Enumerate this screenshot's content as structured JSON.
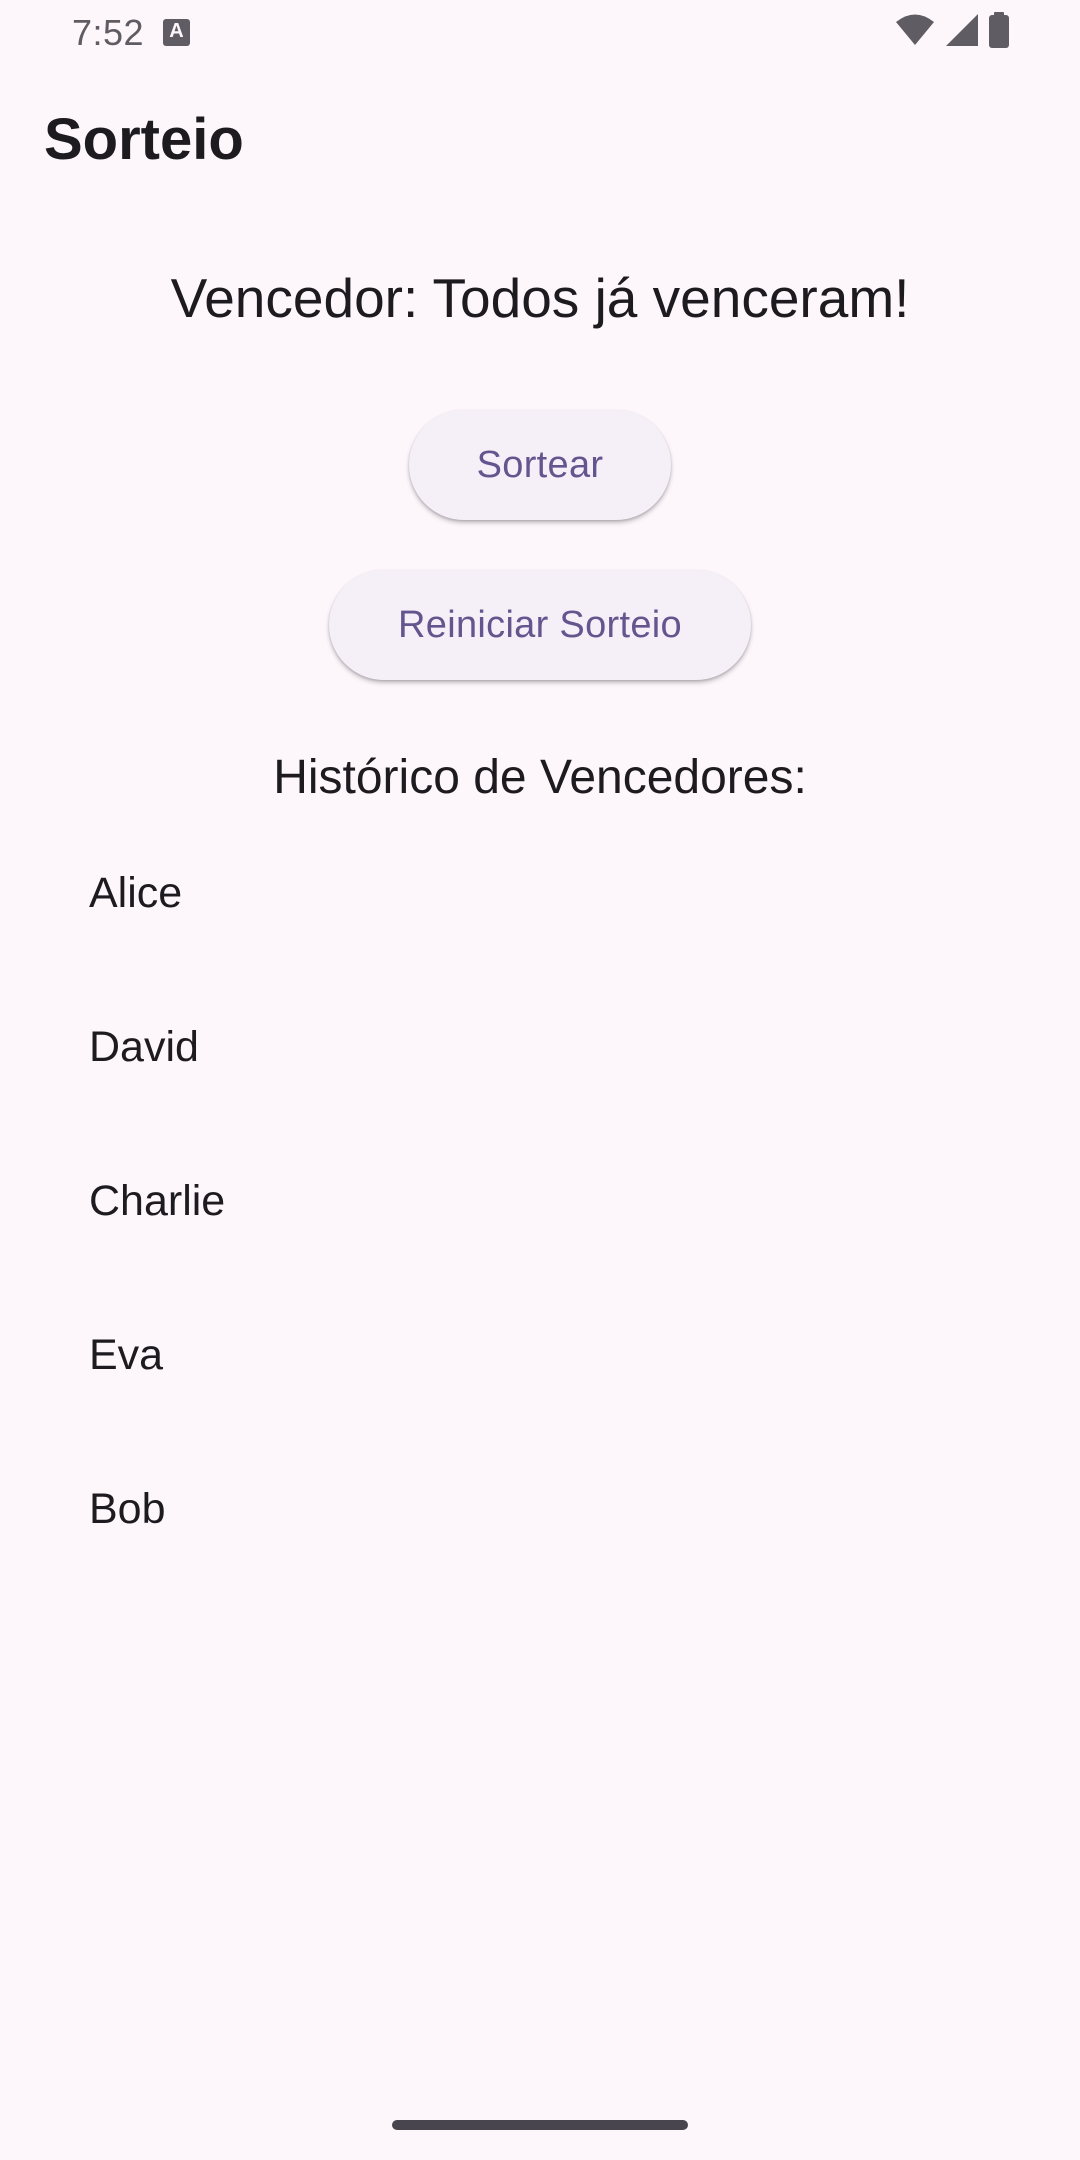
{
  "status_bar": {
    "time": "7:52",
    "notification_icon": "text-a-icon",
    "notification_glyph": "A",
    "icons": [
      "wifi-icon",
      "cell-signal-icon",
      "battery-icon"
    ]
  },
  "app_bar": {
    "title": "Sorteio"
  },
  "main": {
    "winner_text": "Vencedor: Todos já venceram!",
    "draw_button_label": "Sortear",
    "reset_button_label": "Reiniciar Sorteio",
    "history_title": "Histórico de Vencedores:",
    "history": [
      "Alice",
      "David",
      "Charlie",
      "Eva",
      "Bob"
    ]
  },
  "colors": {
    "background": "#fdf7fc",
    "button_background": "#f5eff7",
    "button_text": "#65558f",
    "text": "#1d1b20",
    "status_icons": "#5f5c63"
  }
}
